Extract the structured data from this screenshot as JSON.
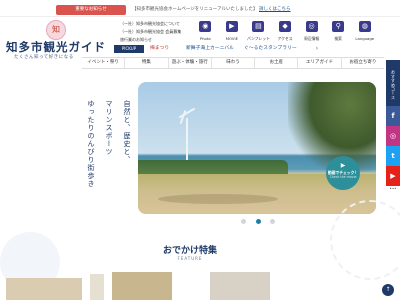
{
  "notice": {
    "label": "重要なお知らせ",
    "text": "【知多市観光協会ホームページをリニューアルいたしました】",
    "link": "詳しくはこちら"
  },
  "logo": {
    "seal": "知",
    "title": "知多市観光ガイド",
    "subtitle": "たくさん知って好きになる"
  },
  "info_links": [
    "（一社）知多市観光協会について",
    "（一社）知多市観光協会 会員募集",
    "旅行業のお知らせ"
  ],
  "quick_links": [
    {
      "label": "Photo",
      "icon": "camera-icon",
      "glyph": "◉"
    },
    {
      "label": "MOVIE",
      "icon": "movie-icon",
      "glyph": "▶"
    },
    {
      "label": "パンフレット",
      "icon": "pamphlet-icon",
      "glyph": "▤"
    },
    {
      "label": "アクセス",
      "icon": "car-icon",
      "glyph": "◆"
    },
    {
      "label": "周辺情報",
      "icon": "map-icon",
      "glyph": "◎"
    },
    {
      "label": "検索",
      "icon": "search-icon",
      "glyph": "⚲"
    },
    {
      "label": "Language",
      "icon": "globe-icon",
      "glyph": "◍"
    }
  ],
  "pickup": {
    "tag": "PICKUP",
    "items": [
      "梅まつり",
      "新舞子海上カーニバル",
      "ぐ～るたスタンプラリー"
    ],
    "more": "›"
  },
  "nav": [
    "イベント・祭り",
    "特集",
    "遊ぶ・体験・旅行",
    "味わう",
    "お土産",
    "エリアガイド",
    "お宿立ち寄り"
  ],
  "side": {
    "course": "おすすめコース",
    "sns": [
      {
        "icon": "facebook-icon",
        "glyph": "f"
      },
      {
        "icon": "instagram-icon",
        "glyph": "◎"
      },
      {
        "icon": "twitter-icon",
        "glyph": "t"
      },
      {
        "icon": "youtube-icon",
        "glyph": "▶"
      }
    ],
    "more": "•••"
  },
  "tagline": [
    "自然と、歴史と、",
    "マリンスポーツ",
    "ゆったりのんびり街歩き"
  ],
  "hero": {
    "play_icon": "▶",
    "check_label": "動画でチェック！",
    "check_sub": "Check the movie"
  },
  "slider": {
    "count": 3,
    "active": 2
  },
  "feature": {
    "title": "おでかけ特集",
    "subtitle": "FEATURE"
  },
  "page_top": "↑"
}
